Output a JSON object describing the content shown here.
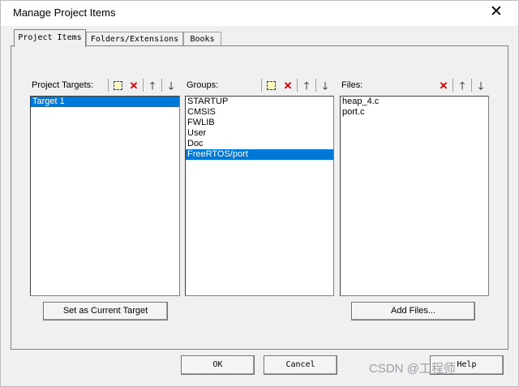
{
  "window": {
    "title": "Manage Project Items",
    "close_icon": "close-icon"
  },
  "tabs": [
    "Project Items",
    "Folders/Extensions",
    "Books"
  ],
  "targets": {
    "label": "Project Targets:",
    "items": [
      "Target 1"
    ],
    "selected": "Target 1",
    "button": "Set as Current Target"
  },
  "groups": {
    "label": "Groups:",
    "items": [
      "STARTUP",
      "CMSIS",
      "FWLIB",
      "User",
      "Doc",
      "FreeRTOS/port"
    ],
    "selected": "FreeRTOS/port"
  },
  "files": {
    "label": "Files:",
    "items": [
      "heap_4.c",
      "port.c"
    ],
    "button": "Add Files..."
  },
  "footer": {
    "ok": "OK",
    "cancel": "Cancel",
    "help": "Help"
  },
  "watermark": "CSDN @工程师"
}
